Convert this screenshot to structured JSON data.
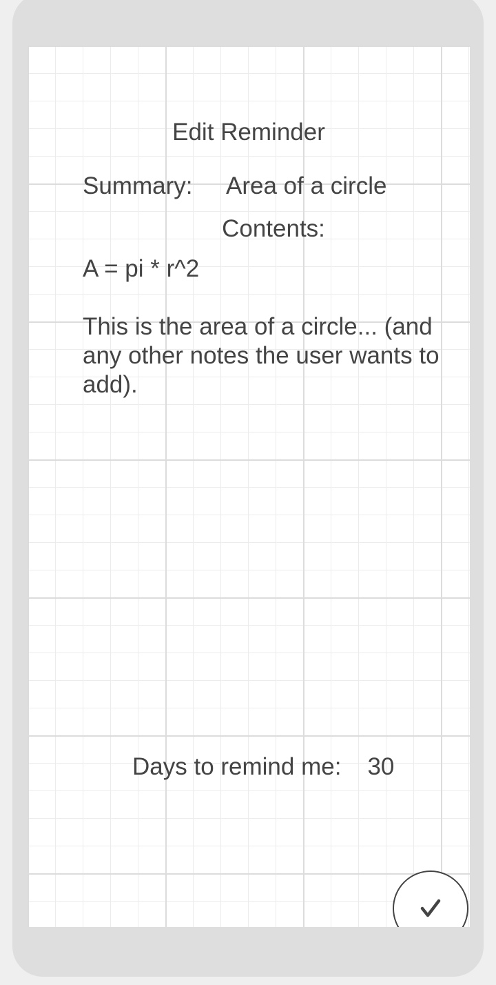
{
  "header": {
    "title": "Edit Reminder"
  },
  "summary": {
    "label": "Summary:",
    "value": "Area of a circle"
  },
  "contents": {
    "label": "Contents:",
    "text": "A = pi * r^2\n\nThis is the area of a circle... (and any other notes the user wants to add)."
  },
  "remind": {
    "label": "Days to remind me:",
    "value": "30"
  },
  "confirm": {
    "icon": "checkmark-icon"
  },
  "colors": {
    "text": "#444444",
    "frame": "#dedede",
    "grid_major": "#dcdcdc",
    "grid_minor": "#ececec"
  }
}
